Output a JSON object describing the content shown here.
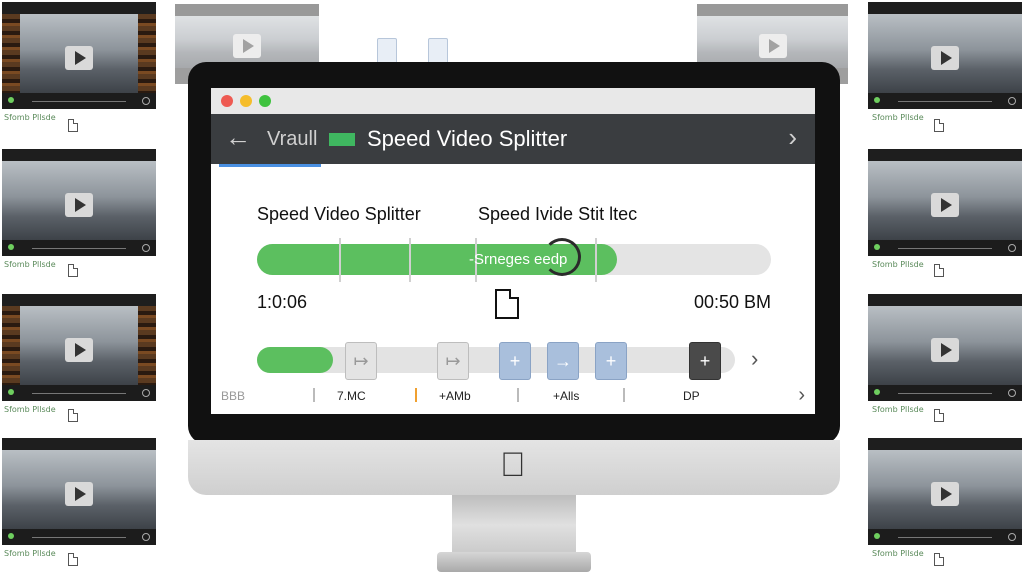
{
  "window": {
    "nav_text": "Vraull",
    "title": "Speed Video Splitter"
  },
  "main": {
    "heading_left": "Speed Video Splitter",
    "heading_right": "Speed Ivide Stit ltec",
    "progress": {
      "text": "-Srneges eedp",
      "fraction": 0.7
    },
    "time_start": "1:0:06",
    "time_end": "00:50 BM",
    "segments": {
      "fill_fraction": 0.16
    }
  },
  "bottom_bar": {
    "items": [
      "BBB",
      "7.MC",
      "+AMb",
      "+Alls",
      "DP"
    ]
  },
  "thumbnails": {
    "label": "Sfomb Pllsde"
  },
  "colors": {
    "accent_green": "#5cbf5f",
    "toolbar": "#3a3d40",
    "clip_blue": "#a9bfdc",
    "tab_blue": "#4a90e2"
  },
  "icons": [
    "back-arrow-icon",
    "forward-arrow-icon",
    "document-icon",
    "play-icon",
    "apple-logo-icon",
    "chevron-right-icon"
  ]
}
